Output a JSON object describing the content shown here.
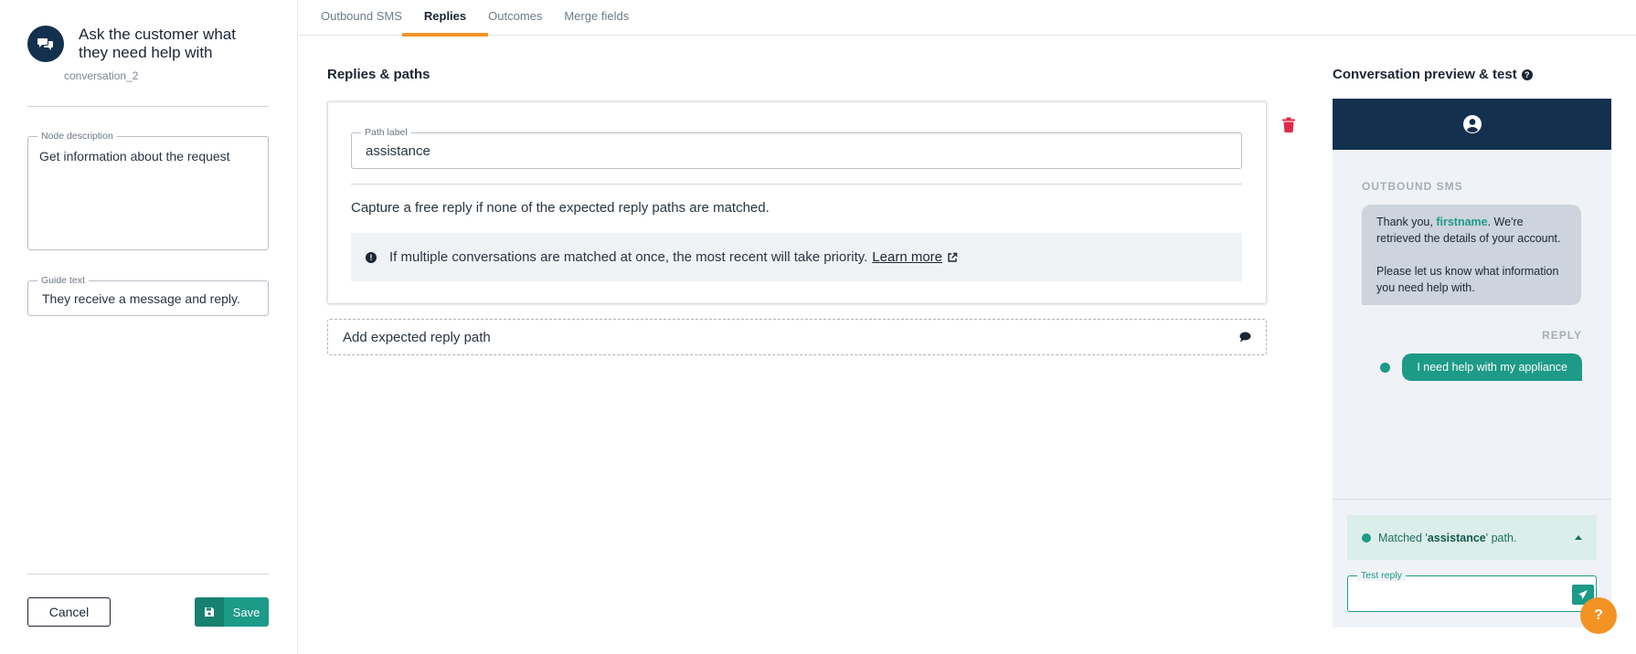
{
  "node": {
    "title": "Ask the customer what they need help with",
    "id": "conversation_2"
  },
  "fields": {
    "node_description_label": "Node description",
    "node_description_value": "Get information about the request",
    "guide_text_label": "Guide text",
    "guide_text_value": "They receive a message and reply."
  },
  "footer": {
    "cancel_label": "Cancel",
    "save_label": "Save"
  },
  "tabs": [
    {
      "label": "Outbound SMS",
      "active": false
    },
    {
      "label": "Replies",
      "active": true
    },
    {
      "label": "Outcomes",
      "active": false
    },
    {
      "label": "Merge fields",
      "active": false
    }
  ],
  "main": {
    "section_title": "Replies & paths",
    "path_label_legend": "Path label",
    "path_label_value": "assistance",
    "capture_text": "Capture a free reply if none of the expected reply paths are matched.",
    "info_text": "If multiple conversations are matched at once, the most recent will take priority.",
    "learn_more": "Learn more",
    "add_path_label": "Add expected reply path"
  },
  "preview": {
    "title": "Conversation preview & test",
    "outbound_label": "OUTBOUND SMS",
    "msg_part1": "Thank you, ",
    "msg_highlight": "firstname",
    "msg_part2": ". We're retrieved the details of your account.",
    "msg_part3": "Please let us know what information you need help with.",
    "reply_label": "REPLY",
    "reply_text": "I need help with my appliance",
    "matched_prefix": "Matched '",
    "matched_path": "assistance",
    "matched_suffix": "' path.",
    "test_reply_label": "Test reply"
  },
  "colors": {
    "navy": "#13304f",
    "teal": "#1d9a88",
    "orange": "#f39324",
    "danger": "#e0294a"
  }
}
